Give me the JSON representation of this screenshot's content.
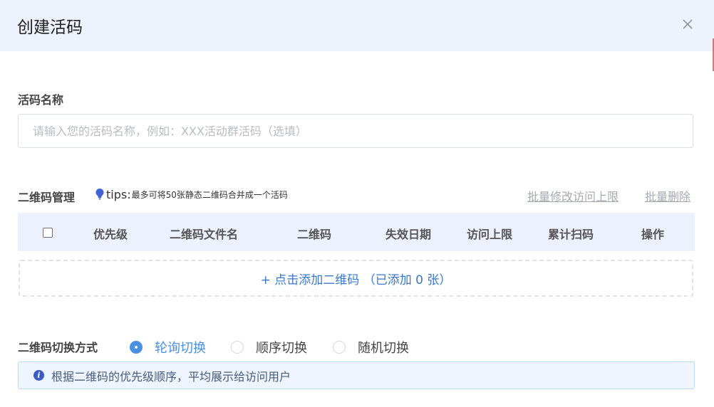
{
  "dialog": {
    "title": "创建活码",
    "close_icon": "close-icon"
  },
  "name_field": {
    "label": "活码名称",
    "value": "",
    "placeholder": "请输入您的活码名称，例如：XXX活动群活码（选填）"
  },
  "qr_manage": {
    "label": "二维码管理",
    "tips_icon": "lightbulb-icon",
    "tips_label": "tips:",
    "tips_text": "最多可将50张静态二维码合并成一个活码",
    "batch_edit_link": "批量修改访问上限",
    "batch_delete_link": "批量删除"
  },
  "table": {
    "columns": [
      "优先级",
      "二维码文件名",
      "二维码",
      "失效日期",
      "访问上限",
      "累计扫码",
      "操作"
    ]
  },
  "add_zone": {
    "text": "+ 点击添加二维码 （已添加 0 张）"
  },
  "switch_mode": {
    "label": "二维码切换方式",
    "options": [
      "轮询切换",
      "顺序切换",
      "随机切换"
    ],
    "selected": "轮询切换"
  },
  "info": {
    "icon": "info-icon",
    "text": "根据二维码的优先级顺序，平均展示给访问用户"
  },
  "colors": {
    "header_bg": "#eef2fc",
    "accent": "#4a90e2",
    "link_blue": "#3a78c8",
    "info_bg": "#eef5ff"
  }
}
